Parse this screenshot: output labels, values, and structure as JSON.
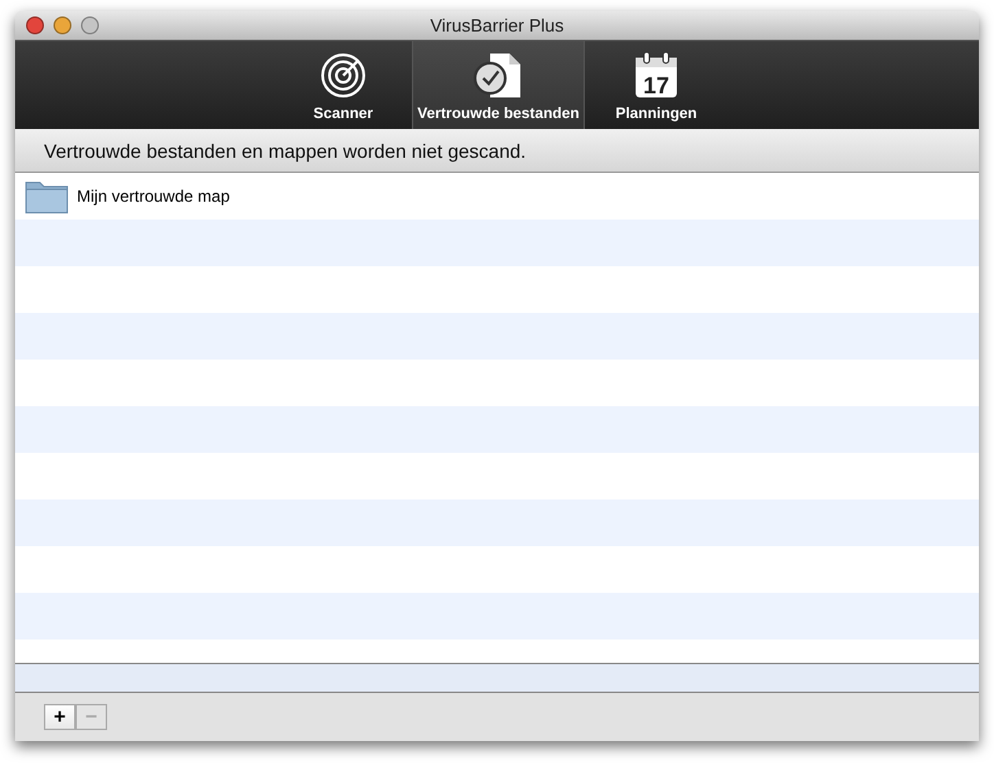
{
  "window": {
    "title": "VirusBarrier Plus"
  },
  "toolbar": [
    {
      "label": "Scanner",
      "selected": false
    },
    {
      "label": "Vertrouwde bestanden",
      "selected": true
    },
    {
      "label": "Planningen",
      "selected": false,
      "day": "17"
    }
  ],
  "info": "Vertrouwde bestanden en mappen worden niet gescand.",
  "items": [
    {
      "name": "Mijn vertrouwde map"
    }
  ],
  "buttons": [
    {
      "label": "+",
      "disabled": false
    },
    {
      "label": "−",
      "disabled": true
    }
  ]
}
